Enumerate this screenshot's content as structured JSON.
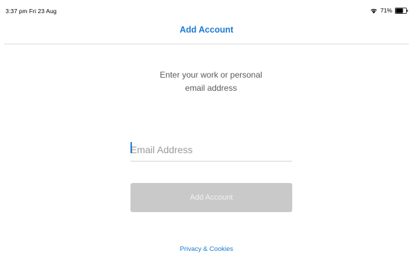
{
  "status_bar": {
    "time_date": "3:37 pm  Fri 23 Aug",
    "battery_percent": "71%",
    "battery_level": 0.71,
    "icons": [
      "wifi-icon",
      "battery-icon"
    ]
  },
  "nav": {
    "title": "Add Account"
  },
  "instructions": {
    "line1": "Enter your work or personal",
    "line2": "email address"
  },
  "email_field": {
    "value": "",
    "placeholder": "Email Address"
  },
  "add_button": {
    "label": "Add Account",
    "enabled": false
  },
  "footer": {
    "privacy_link": "Privacy & Cookies"
  },
  "colors": {
    "accent": "#1f7ad1",
    "button_disabled_bg": "#c9c9c9",
    "button_disabled_text": "#f2f2f2",
    "body_text": "#5a5a5a",
    "divider": "#dcdcdc"
  }
}
